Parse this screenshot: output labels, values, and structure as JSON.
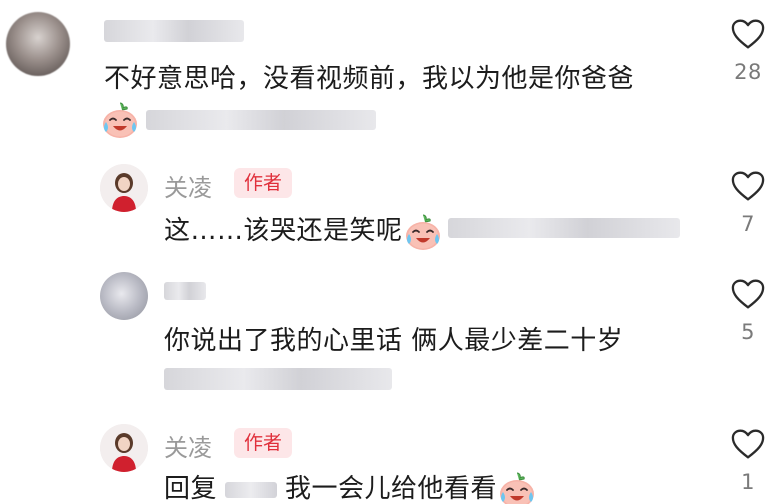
{
  "comments": [
    {
      "name": "",
      "text": "不好意思哈，没看视频前，我以为他是你爸爸",
      "likes": "28"
    },
    {
      "name": "关凌",
      "tag": "作者",
      "text": "这……该哭还是笑呢",
      "likes": "7"
    },
    {
      "name": "",
      "text": "你说出了我的心里话 俩人最少差二十岁",
      "likes": "5"
    },
    {
      "name": "关凌",
      "tag": "作者",
      "reply_prefix": "回复",
      "text": "我一会儿给他看看",
      "likes": "1"
    }
  ],
  "icons": {
    "like": "heart-outline-icon",
    "emoji": "crying-laughing-emoji"
  },
  "colors": {
    "author_tag_bg": "#fde6e8",
    "author_tag_text": "#e0303c",
    "meta_text": "#9a9a9a"
  }
}
